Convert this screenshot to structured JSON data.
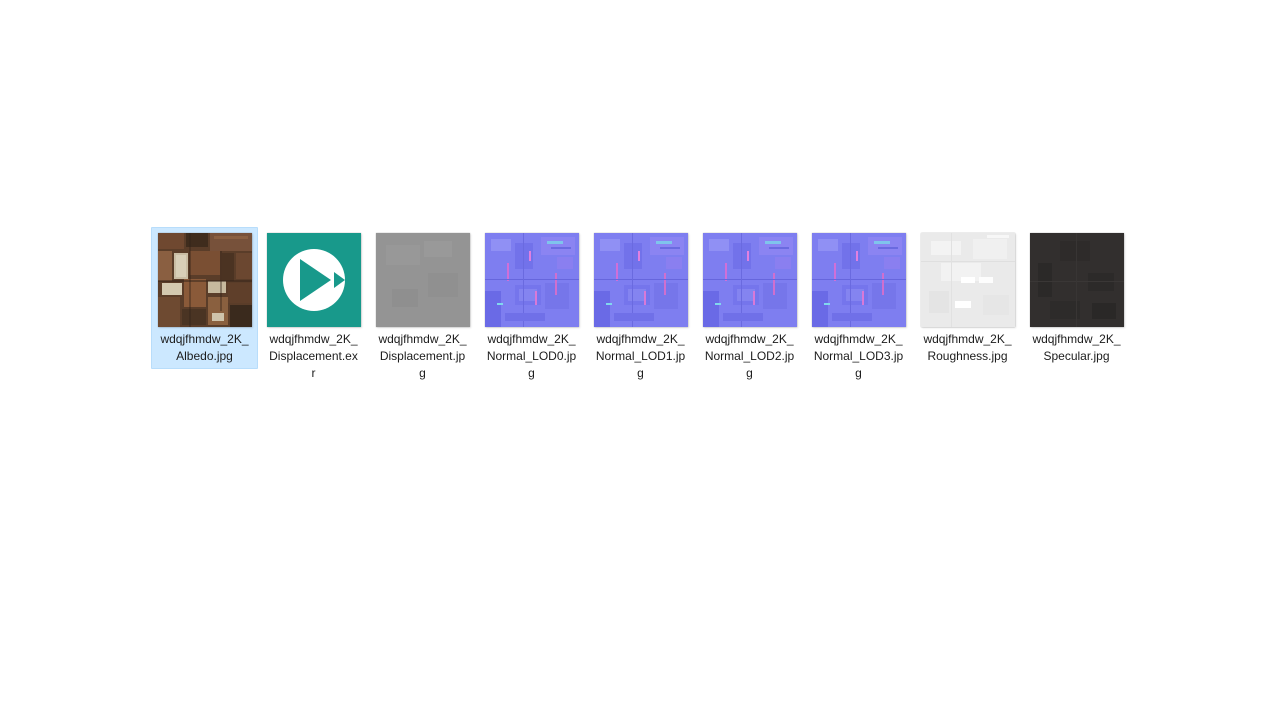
{
  "window": {
    "background": "#ffffff",
    "view": "large-icons-file-grid"
  },
  "colors": {
    "selection_fill": "#cce8ff",
    "selection_border": "#b8ddfb",
    "exr_teal": "#18998b",
    "normal_map_base": "#7e7ef0",
    "displacement_gray": "#949494",
    "roughness_light": "#eaeaea",
    "specular_dark": "#322f2e",
    "albedo_wood_brown": "#5a3d29",
    "label_text": "#1c1c1c"
  },
  "icons": {
    "exr_icon": "play-circle"
  },
  "files": [
    {
      "name": "wdqjfhmdw_2K_Albedo.jpg",
      "selected": true,
      "thumb_kind": "albedo-wood-texture"
    },
    {
      "name": "wdqjfhmdw_2K_Displacement.exr",
      "selected": false,
      "thumb_kind": "exr-play-icon"
    },
    {
      "name": "wdqjfhmdw_2K_Displacement.jpg",
      "selected": false,
      "thumb_kind": "gray-displacement"
    },
    {
      "name": "wdqjfhmdw_2K_Normal_LOD0.jpg",
      "selected": false,
      "thumb_kind": "normal-map"
    },
    {
      "name": "wdqjfhmdw_2K_Normal_LOD1.jpg",
      "selected": false,
      "thumb_kind": "normal-map"
    },
    {
      "name": "wdqjfhmdw_2K_Normal_LOD2.jpg",
      "selected": false,
      "thumb_kind": "normal-map"
    },
    {
      "name": "wdqjfhmdw_2K_Normal_LOD3.jpg",
      "selected": false,
      "thumb_kind": "normal-map"
    },
    {
      "name": "wdqjfhmdw_2K_Roughness.jpg",
      "selected": false,
      "thumb_kind": "roughness-light"
    },
    {
      "name": "wdqjfhmdw_2K_Specular.jpg",
      "selected": false,
      "thumb_kind": "specular-dark"
    }
  ]
}
